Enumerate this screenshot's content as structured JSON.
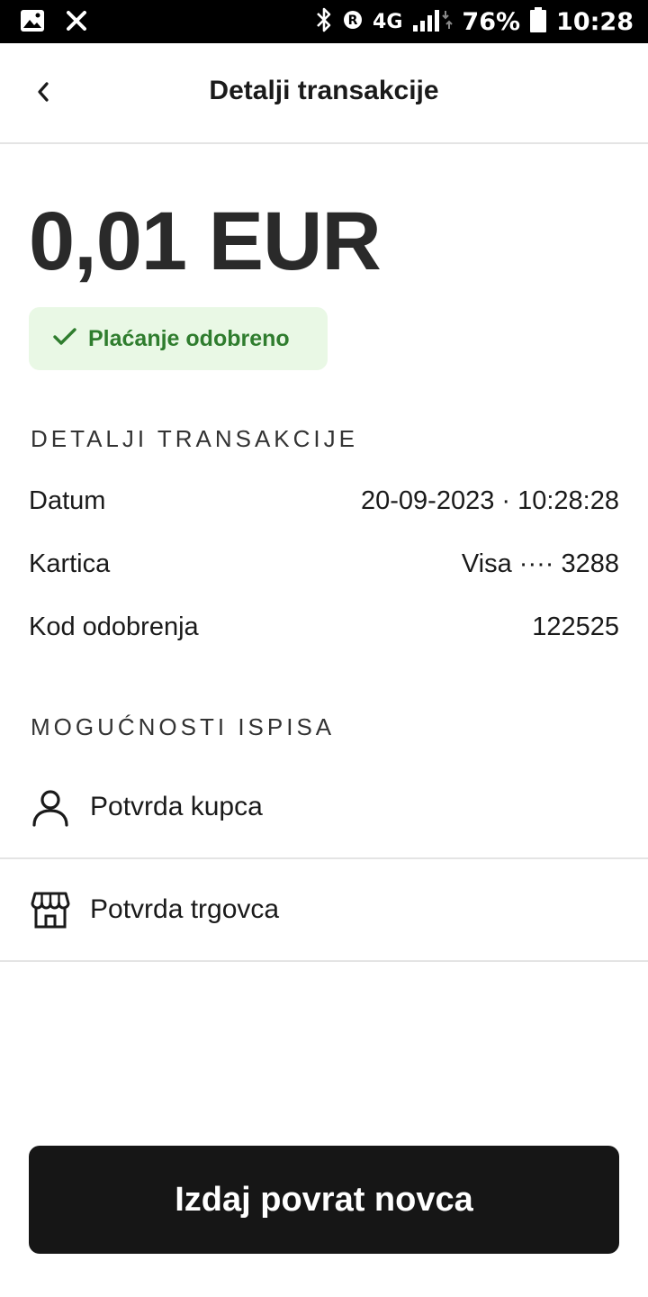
{
  "status_bar": {
    "network": "4G",
    "battery": "76%",
    "time": "10:28",
    "icons": [
      "image-icon",
      "app-notification-icon",
      "bluetooth-icon",
      "registered-icon",
      "signal-icon",
      "battery-icon"
    ]
  },
  "header": {
    "title": "Detalji transakcije",
    "back_icon": "chevron-left-icon"
  },
  "transaction": {
    "amount": "0,01 EUR",
    "status": {
      "label": "Plaćanje odobreno",
      "icon": "check-icon",
      "color": "#2f7d2e",
      "background": "#e9f8e5"
    }
  },
  "details": {
    "section_title": "DETALJI TRANSAKCIJE",
    "rows": [
      {
        "label": "Datum",
        "value": "20-09-2023 · 10:28:28"
      },
      {
        "label": "Kartica",
        "value": "Visa ···· 3288"
      },
      {
        "label": "Kod odobrenja",
        "value": "122525"
      }
    ]
  },
  "print_options": {
    "section_title": "MOGUĆNOSTI ISPISA",
    "items": [
      {
        "label": "Potvrda kupca",
        "icon": "person-icon"
      },
      {
        "label": "Potvrda trgovca",
        "icon": "store-icon"
      }
    ]
  },
  "actions": {
    "refund_label": "Izdaj povrat novca"
  }
}
